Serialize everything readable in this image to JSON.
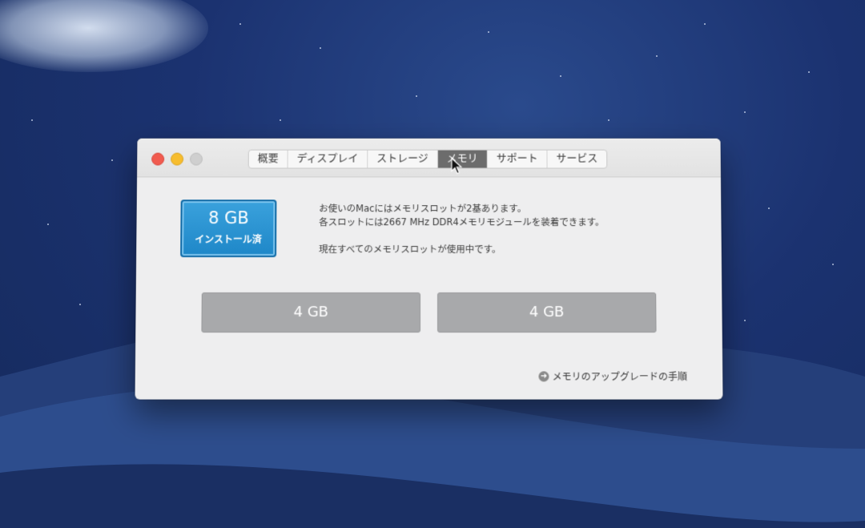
{
  "window": {
    "tabs": [
      {
        "label": "概要"
      },
      {
        "label": "ディスプレイ"
      },
      {
        "label": "ストレージ"
      },
      {
        "label": "メモリ"
      },
      {
        "label": "サポート"
      },
      {
        "label": "サービス"
      }
    ],
    "active_tab": "メモリ"
  },
  "memory": {
    "installed_size": "8 GB",
    "installed_label": "インストール済",
    "info_line1": "お使いのMacにはメモリスロットが2基あります。",
    "info_line2": "各スロットには2667 MHz DDR4メモリモジュールを装着できます。",
    "info_line3": "現在すべてのメモリスロットが使用中です。",
    "slots": [
      {
        "label": "4 GB"
      },
      {
        "label": "4 GB"
      }
    ],
    "upgrade_link": "メモリのアップグレードの手順"
  },
  "icons": {
    "upgrade_icon": "arrow-circle-right-icon"
  },
  "colors": {
    "badge_blue": "#1e87c8",
    "active_tab": "#6c6c6c",
    "slot_gray": "#a8a9ab"
  }
}
